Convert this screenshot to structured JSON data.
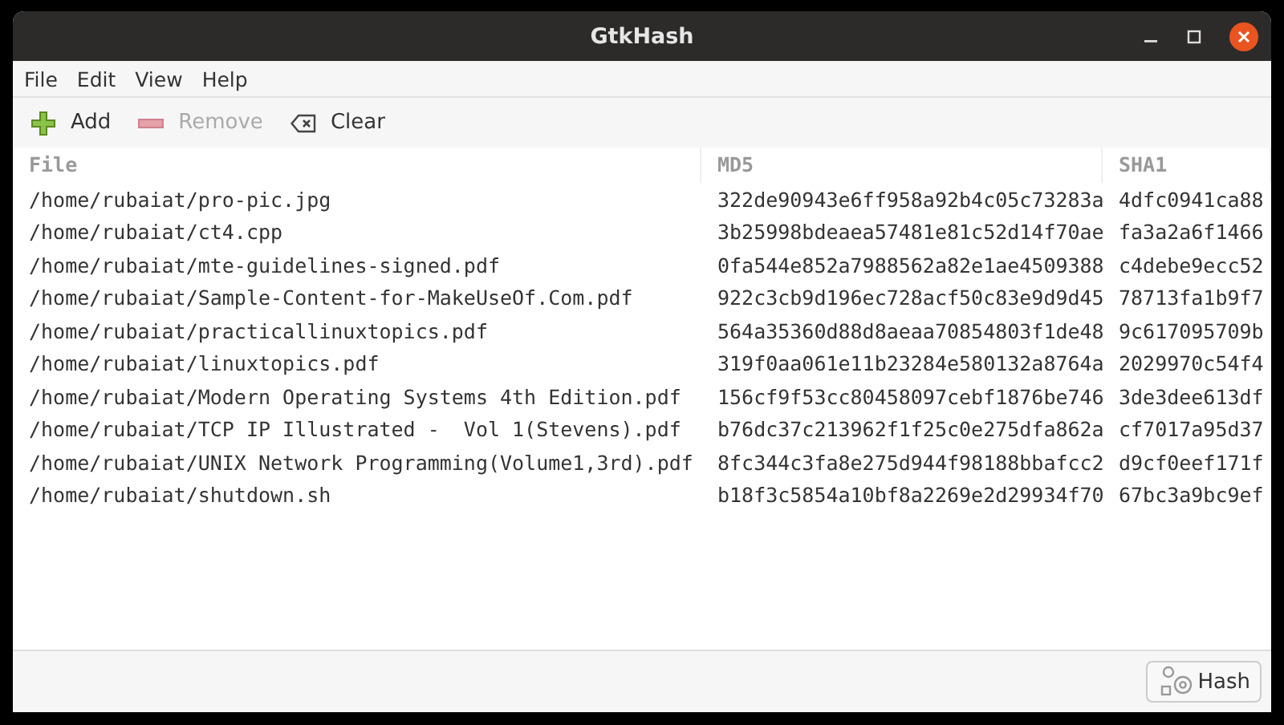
{
  "window": {
    "title": "GtkHash"
  },
  "menu": [
    "File",
    "Edit",
    "View",
    "Help"
  ],
  "toolbar": [
    {
      "kind": "add",
      "label": "Add",
      "disabled": false
    },
    {
      "kind": "remove",
      "label": "Remove",
      "disabled": true
    },
    {
      "kind": "clear",
      "label": "Clear",
      "disabled": false
    }
  ],
  "table": {
    "columns": [
      "File",
      "MD5",
      "SHA1"
    ],
    "rows": [
      [
        "/home/rubaiat/pro-pic.jpg",
        "322de90943e6ff958a92b4c05c73283a",
        "4dfc0941ca88"
      ],
      [
        "/home/rubaiat/ct4.cpp",
        "3b25998bdeaea57481e81c52d14f70ae",
        "fa3a2a6f1466"
      ],
      [
        "/home/rubaiat/mte-guidelines-signed.pdf",
        "0fa544e852a7988562a82e1ae4509388",
        "c4debe9ecc52"
      ],
      [
        "/home/rubaiat/Sample-Content-for-MakeUseOf.Com.pdf",
        "922c3cb9d196ec728acf50c83e9d9d45",
        "78713fa1b9f7"
      ],
      [
        "/home/rubaiat/practicallinuxtopics.pdf",
        "564a35360d88d8aeaa70854803f1de48",
        "9c617095709b"
      ],
      [
        "/home/rubaiat/linuxtopics.pdf",
        "319f0aa061e11b23284e580132a8764a",
        "2029970c54f4"
      ],
      [
        "/home/rubaiat/Modern Operating Systems 4th Edition.pdf",
        "156cf9f53cc80458097cebf1876be746",
        "3de3dee613df"
      ],
      [
        "/home/rubaiat/TCP IP Illustrated -  Vol 1(Stevens).pdf",
        "b76dc37c213962f1f25c0e275dfa862a",
        "cf7017a95d37"
      ],
      [
        "/home/rubaiat/UNIX Network Programming(Volume1,3rd).pdf",
        "8fc344c3fa8e275d944f98188bbafcc2",
        "d9cf0eef171f"
      ],
      [
        "/home/rubaiat/shutdown.sh",
        "b18f3c5854a10bf8a2269e2d29934f70",
        "67bc3a9bc9ef"
      ]
    ]
  },
  "hash_button": "Hash"
}
